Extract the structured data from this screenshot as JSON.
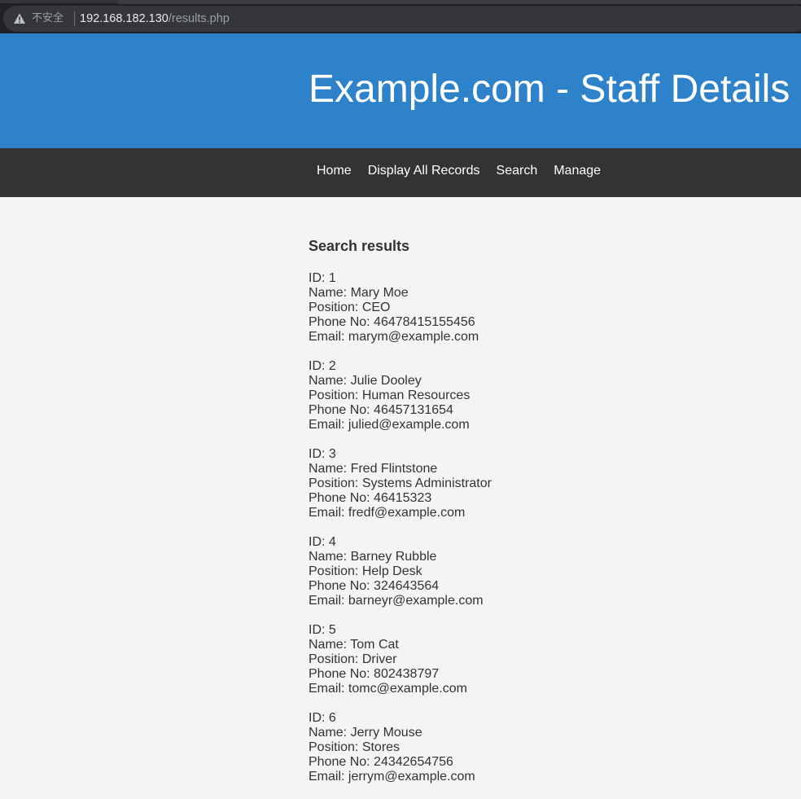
{
  "browser": {
    "insecure_label": "不安全",
    "url_host": "192.168.182.130",
    "url_path": "/results.php",
    "icon": "warning-triangle-icon"
  },
  "header": {
    "title": "Example.com - Staff Details"
  },
  "nav": {
    "items": [
      {
        "label": "Home"
      },
      {
        "label": "Display All Records"
      },
      {
        "label": "Search"
      },
      {
        "label": "Manage"
      }
    ]
  },
  "main": {
    "heading": "Search results",
    "records": [
      {
        "id": "ID: 1",
        "name": "Name: Mary Moe",
        "position": "Position: CEO",
        "phone": "Phone No: 46478415155456",
        "email": "Email: marym@example.com"
      },
      {
        "id": "ID: 2",
        "name": "Name: Julie Dooley",
        "position": "Position: Human Resources",
        "phone": "Phone No: 46457131654",
        "email": "Email: julied@example.com"
      },
      {
        "id": "ID: 3",
        "name": "Name: Fred Flintstone",
        "position": "Position: Systems Administrator",
        "phone": "Phone No: 46415323",
        "email": "Email: fredf@example.com"
      },
      {
        "id": "ID: 4",
        "name": "Name: Barney Rubble",
        "position": "Position: Help Desk",
        "phone": "Phone No: 324643564",
        "email": "Email: barneyr@example.com"
      },
      {
        "id": "ID: 5",
        "name": "Name: Tom Cat",
        "position": "Position: Driver",
        "phone": "Phone No: 802438797",
        "email": "Email: tomc@example.com"
      },
      {
        "id": "ID: 6",
        "name": "Name: Jerry Mouse",
        "position": "Position: Stores",
        "phone": "Phone No: 24342654756",
        "email": "Email: jerrym@example.com"
      }
    ]
  },
  "colors": {
    "header_bg": "#2d82c9",
    "nav_bg": "#333333",
    "page_bg": "#f4f4f4"
  }
}
